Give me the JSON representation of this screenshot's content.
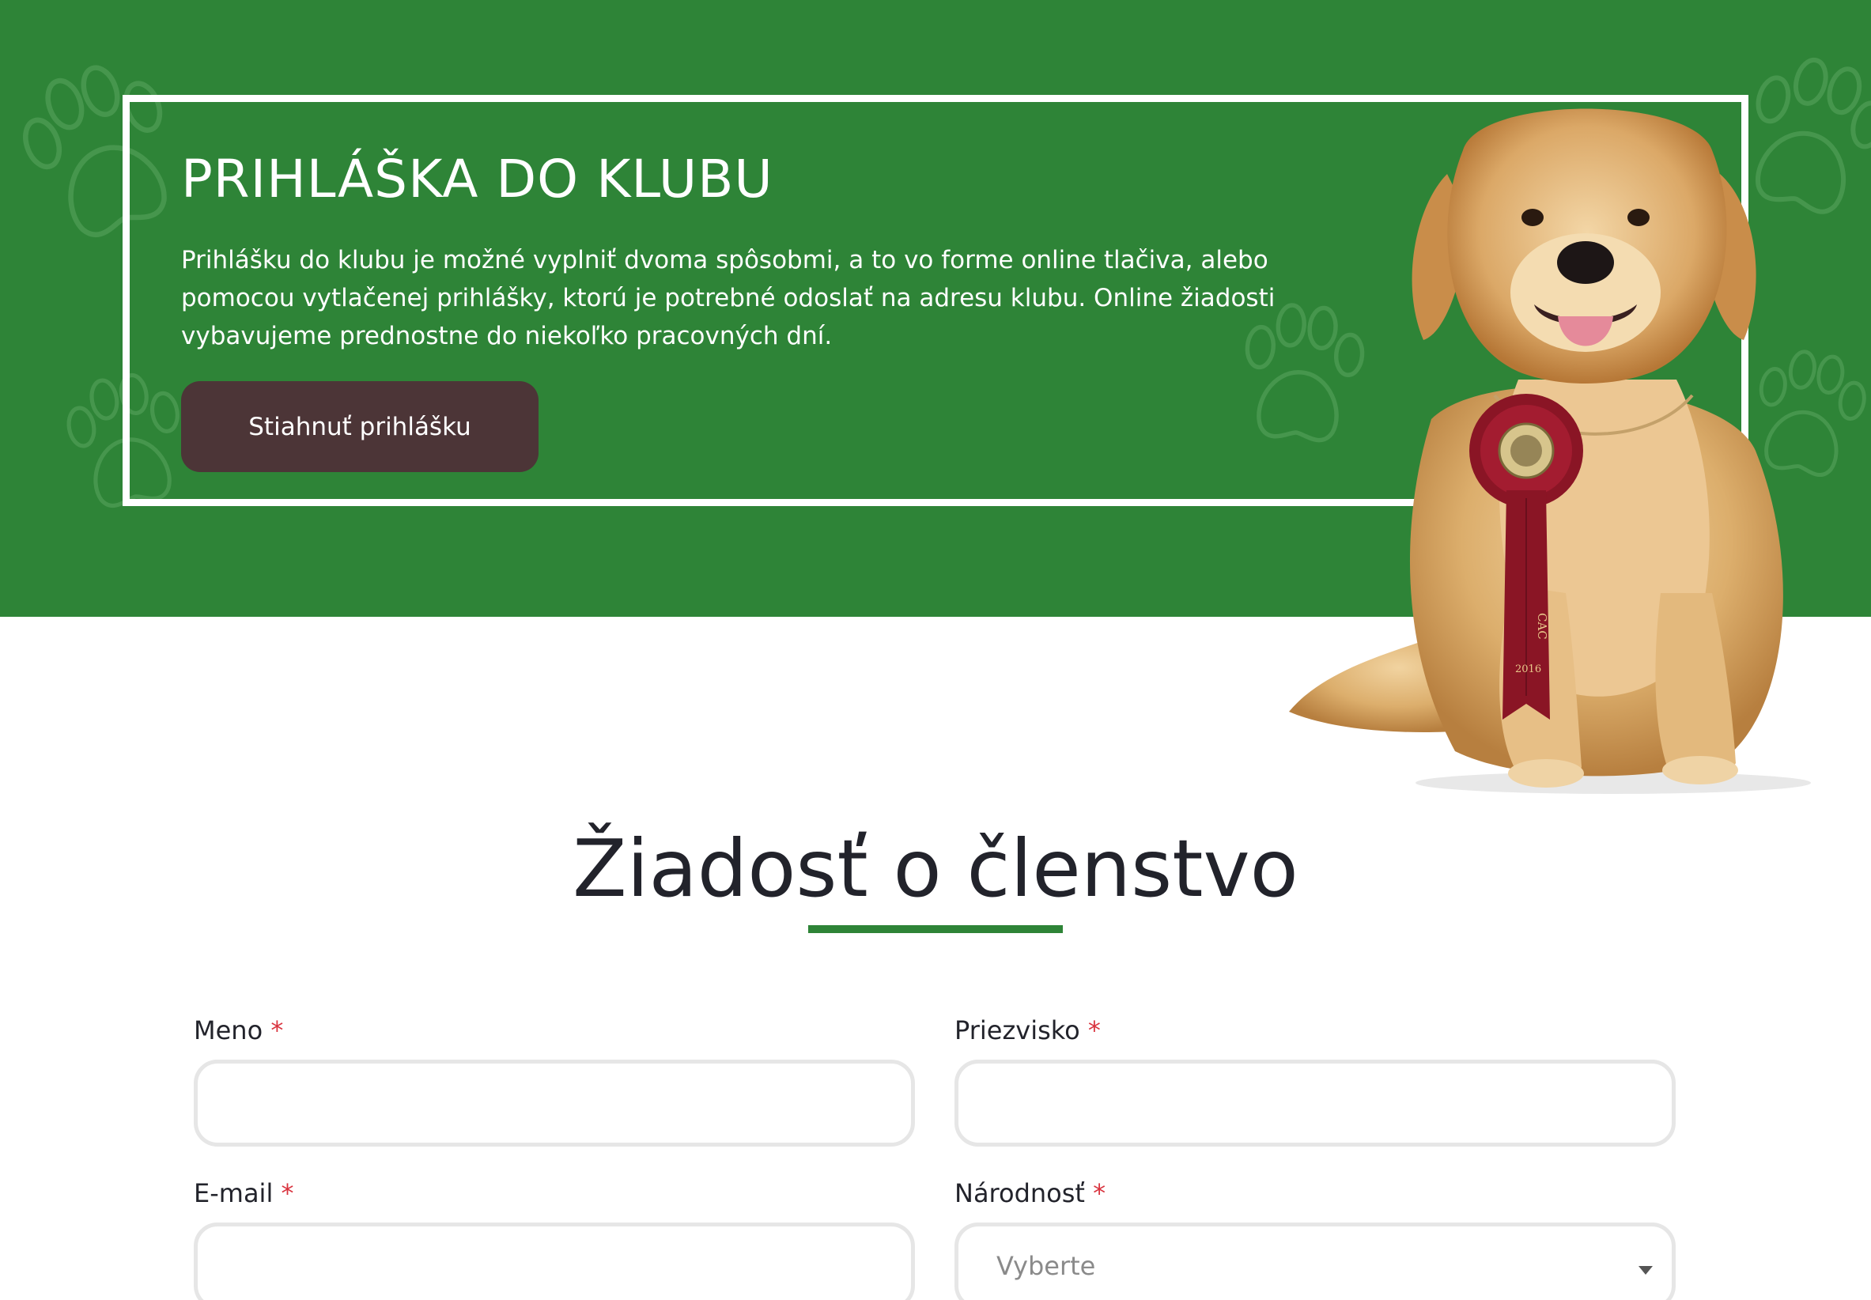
{
  "colors": {
    "hero_green": "#2e8437",
    "button_brown": "#4c3537",
    "required_red": "#d9343f",
    "input_border": "#e6e6e6",
    "heading_dark": "#22232b"
  },
  "hero": {
    "title": "PRIHLÁŠKA DO KLUBU",
    "text": "Prihlášku do klubu je možné vyplniť dvoma spôsobmi, a to vo forme online tlačiva, alebo pomocou vytlačenej prihlášky, ktorú je potrebné odoslať na adresu klubu. Online žiadosti vybavujeme prednostne do niekoľko pracovných dní.",
    "download_button": "Stiahnuť prihlášku",
    "image": "golden-retriever-with-rosette-image",
    "rosette_text": "CAC",
    "rosette_year": "2016"
  },
  "form": {
    "title": "Žiadosť o členstvo",
    "required_marker": "*",
    "fields": {
      "first_name": {
        "label": "Meno",
        "value": ""
      },
      "last_name": {
        "label": "Priezvisko",
        "value": ""
      },
      "email": {
        "label": "E-mail",
        "value": ""
      },
      "nationality": {
        "label": "Národnosť",
        "placeholder": "Vyberte"
      }
    }
  }
}
